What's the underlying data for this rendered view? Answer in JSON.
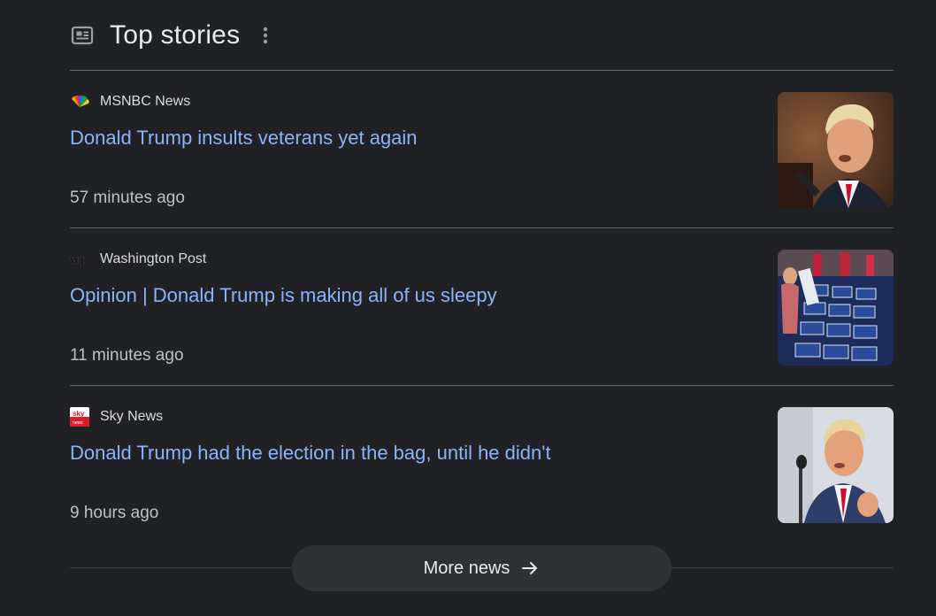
{
  "header": {
    "title": "Top stories",
    "icon": "newspaper-icon",
    "menu_icon": "more-vert-icon"
  },
  "stories": [
    {
      "source": "MSNBC News",
      "source_logo": "peacock-logo",
      "headline": "Donald Trump insults veterans yet again",
      "time": "57 minutes ago",
      "thumbnail": "trump-speaking-photo"
    },
    {
      "source": "Washington Post",
      "source_logo": "wp-logo",
      "headline": "Opinion | Donald Trump is making all of us sleepy",
      "time": "11 minutes ago",
      "thumbnail": "convention-chairs-photo"
    },
    {
      "source": "Sky News",
      "source_logo": "sky-news-logo",
      "headline": "Donald Trump had the election in the bag, until he didn't",
      "time": "9 hours ago",
      "thumbnail": "trump-clapping-photo"
    }
  ],
  "footer": {
    "more_label": "More news",
    "arrow_icon": "arrow-right-icon"
  },
  "colors": {
    "background": "#202124",
    "link": "#8ab4f8",
    "text": "#e8eaed",
    "muted": "#bdc1c6",
    "divider": "#5f6368"
  }
}
